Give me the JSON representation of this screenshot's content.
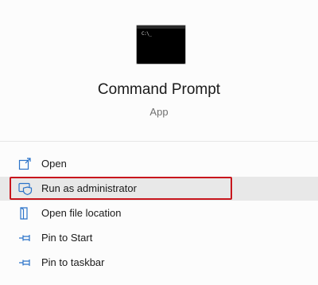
{
  "app": {
    "title": "Command Prompt",
    "type": "App",
    "icon": "command-prompt-icon",
    "prompt_glyph": "C:\\_"
  },
  "menu": {
    "items": [
      {
        "label": "Open",
        "icon": "open-icon"
      },
      {
        "label": "Run as administrator",
        "icon": "shield-icon"
      },
      {
        "label": "Open file location",
        "icon": "file-location-icon"
      },
      {
        "label": "Pin to Start",
        "icon": "pin-icon"
      },
      {
        "label": "Pin to taskbar",
        "icon": "pin-icon"
      }
    ],
    "hovered_item": "Run as administrator"
  },
  "colors": {
    "accent_icon": "#2b73c9",
    "highlight_box": "#c8161d",
    "hover_background": "#e8e8e8"
  }
}
